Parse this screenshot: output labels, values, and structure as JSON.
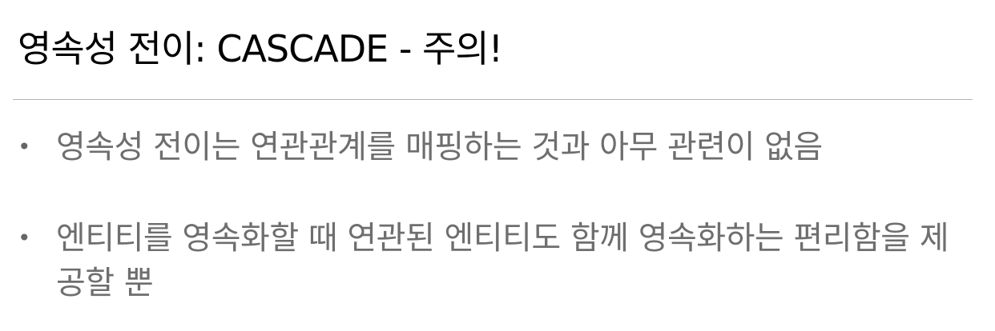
{
  "slide": {
    "title": "영속성 전이: CASCADE - 주의!",
    "bullets": [
      {
        "marker": "•",
        "text": "영속성 전이는 연관관계를 매핑하는 것과 아무 관련이 없음"
      },
      {
        "marker": "•",
        "text": "엔티티를 영속화할 때 연관된 엔티티도 함께 영속화하는 편리함을 제공할 뿐"
      }
    ]
  }
}
